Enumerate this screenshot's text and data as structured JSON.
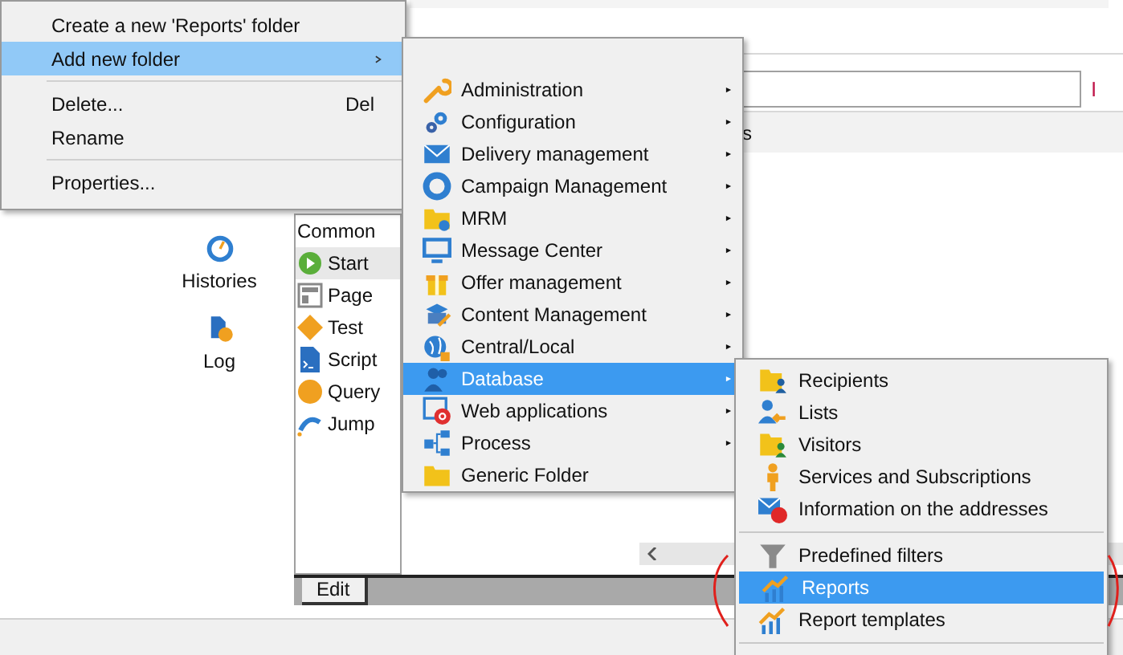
{
  "header": {
    "link_text": "I",
    "tab_text": "s"
  },
  "nav": [
    {
      "label": "Histories"
    },
    {
      "label": "Log"
    }
  ],
  "palette": {
    "title": "Common",
    "items": [
      {
        "label": "Start",
        "selected": true
      },
      {
        "label": "Page",
        "selected": false
      },
      {
        "label": "Test",
        "selected": false
      },
      {
        "label": "Script",
        "selected": false
      },
      {
        "label": "Query",
        "selected": false
      },
      {
        "label": "Jump",
        "selected": false
      }
    ]
  },
  "editor_tabs": [
    {
      "label": "Edit",
      "selected": true
    }
  ],
  "context_menu": {
    "items": [
      {
        "kind": "item",
        "label": "Create a new 'Reports' folder",
        "selected": false,
        "has_submenu": false
      },
      {
        "kind": "item",
        "label": "Add new folder",
        "selected": true,
        "has_submenu": true
      },
      {
        "kind": "separator"
      },
      {
        "kind": "item",
        "label": "Delete...",
        "shortcut": "Del",
        "selected": false,
        "has_submenu": false
      },
      {
        "kind": "item",
        "label": "Rename",
        "selected": false,
        "has_submenu": false
      },
      {
        "kind": "separator"
      },
      {
        "kind": "item",
        "label": "Properties...",
        "selected": false,
        "has_submenu": false
      }
    ]
  },
  "folder_menu": {
    "items": [
      {
        "kind": "item",
        "label": "Administration",
        "selected": false,
        "has_submenu": true
      },
      {
        "kind": "item",
        "label": "Configuration",
        "selected": false,
        "has_submenu": true
      },
      {
        "kind": "item",
        "label": "Delivery management",
        "selected": false,
        "has_submenu": true
      },
      {
        "kind": "item",
        "label": "Campaign Management",
        "selected": false,
        "has_submenu": true
      },
      {
        "kind": "item",
        "label": "MRM",
        "selected": false,
        "has_submenu": true
      },
      {
        "kind": "item",
        "label": "Message Center",
        "selected": false,
        "has_submenu": true
      },
      {
        "kind": "item",
        "label": "Offer management",
        "selected": false,
        "has_submenu": true
      },
      {
        "kind": "item",
        "label": "Content Management",
        "selected": false,
        "has_submenu": true
      },
      {
        "kind": "item",
        "label": "Central/Local",
        "selected": false,
        "has_submenu": true
      },
      {
        "kind": "item",
        "label": "Database",
        "selected": true,
        "has_submenu": true
      },
      {
        "kind": "item",
        "label": "Web applications",
        "selected": false,
        "has_submenu": true
      },
      {
        "kind": "item",
        "label": "Process",
        "selected": false,
        "has_submenu": true
      },
      {
        "kind": "item",
        "label": "Generic Folder",
        "selected": false,
        "has_submenu": false
      }
    ]
  },
  "database_menu": {
    "items": [
      {
        "kind": "item",
        "label": "Recipients",
        "selected": false
      },
      {
        "kind": "item",
        "label": "Lists",
        "selected": false
      },
      {
        "kind": "item",
        "label": "Visitors",
        "selected": false
      },
      {
        "kind": "item",
        "label": "Services and Subscriptions",
        "selected": false
      },
      {
        "kind": "item",
        "label": "Information on the addresses",
        "selected": false
      },
      {
        "kind": "separator"
      },
      {
        "kind": "item",
        "label": "Predefined filters",
        "selected": false
      },
      {
        "kind": "item",
        "label": "Reports",
        "selected": true
      },
      {
        "kind": "item",
        "label": "Report templates",
        "selected": false
      },
      {
        "kind": "separator"
      }
    ]
  }
}
